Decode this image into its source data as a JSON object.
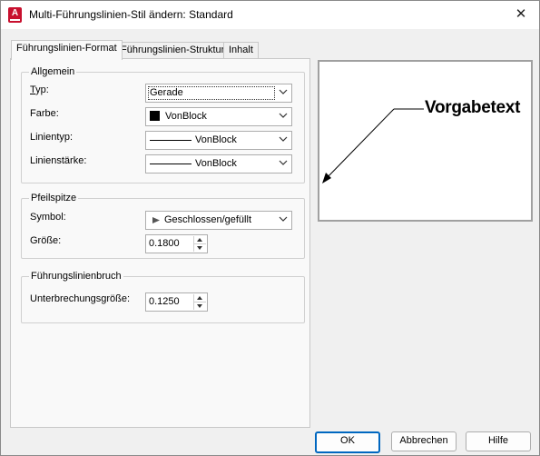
{
  "window": {
    "title": "Multi-Führungslinien-Stil ändern: Standard",
    "app_icon_letter": "A"
  },
  "tabs": [
    {
      "label": "Führungslinien-Format",
      "active": true
    },
    {
      "label": "Führungslinien-Struktur",
      "active": false
    },
    {
      "label": "Inhalt",
      "active": false
    }
  ],
  "groups": {
    "allgemein": {
      "label": "Allgemein",
      "typ": {
        "label": "Typ:",
        "value": "Gerade"
      },
      "farbe": {
        "label": "Farbe:",
        "value": "VonBlock"
      },
      "linientyp": {
        "label": "Linientyp:",
        "value": "VonBlock"
      },
      "linienstaerke": {
        "label": "Linienstärke:",
        "value": "VonBlock"
      }
    },
    "pfeilspitze": {
      "label": "Pfeilspitze",
      "symbol": {
        "label": "Symbol:",
        "value": "Geschlossen/gefüllt"
      },
      "groesse": {
        "label": "Größe:",
        "value": "0.1800"
      }
    },
    "bruch": {
      "label": "Führungslinienbruch",
      "unterbrechung": {
        "label": "Unterbrechungsgröße:",
        "value": "0.1250"
      }
    }
  },
  "preview": {
    "text": "Vorgabetext"
  },
  "buttons": {
    "ok": "OK",
    "cancel": "Abbrechen",
    "help": "Hilfe"
  },
  "colors": {
    "accent": "#0067c0",
    "app_icon": "#c8102e"
  }
}
